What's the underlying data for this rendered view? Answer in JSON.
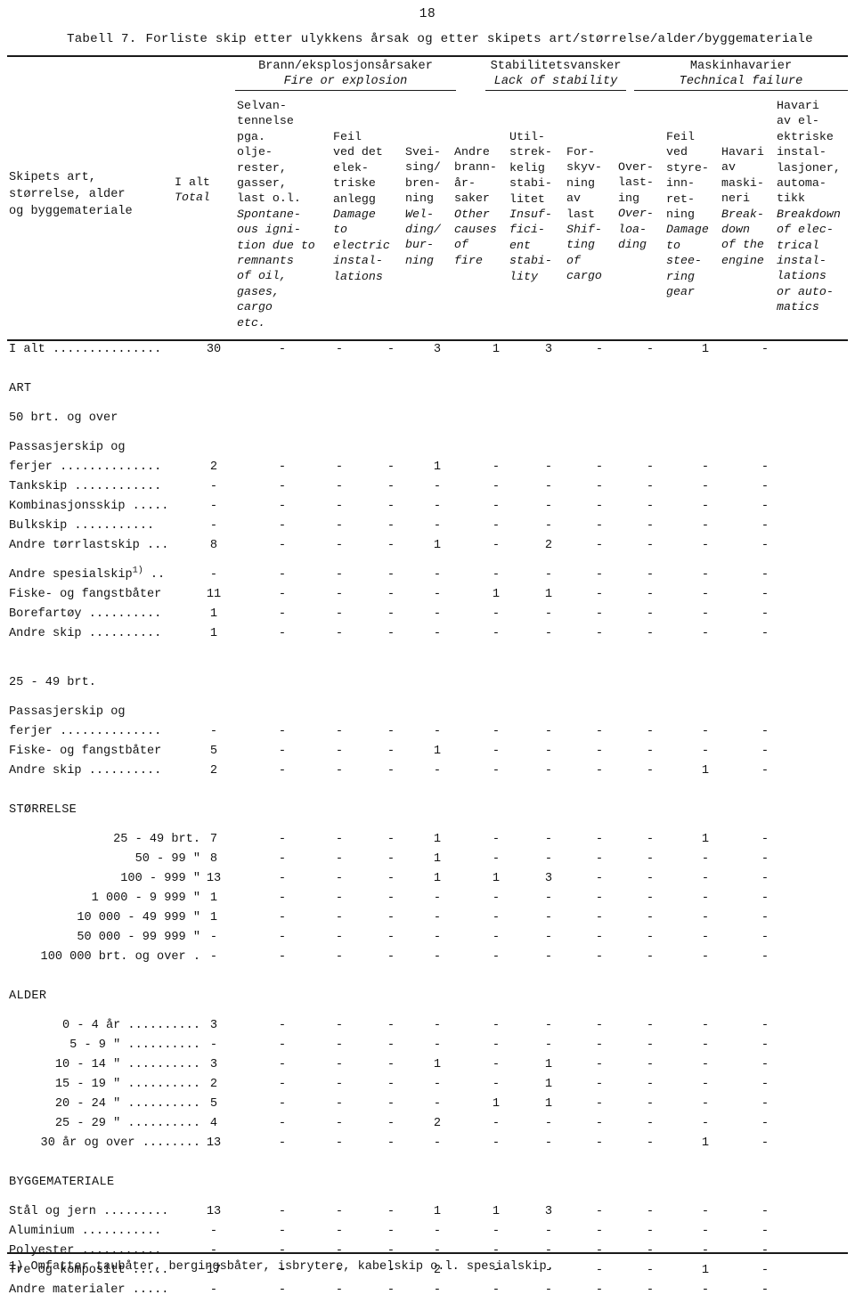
{
  "page": {
    "number": "18"
  },
  "caption": {
    "number": "Tabell 7.",
    "text": "Forliste skip etter ulykkens årsak og etter skipets art/størrelse/alder/byggemateriale"
  },
  "column_groups": [
    {
      "no": "Brann/eksplosjonsårsaker",
      "en": "Fire or explosion"
    },
    {
      "no": "Stabilitetsvansker",
      "en": "Lack of stability"
    },
    {
      "no": "Maskinhavarier",
      "en": "Technical failure"
    }
  ],
  "stub_header": {
    "line1": "Skipets art,",
    "line2": "størrelse, alder",
    "line3": "og byggemateriale"
  },
  "columns": [
    {
      "no": "I alt",
      "en": "Total"
    },
    {
      "no": "Selvan-\ntennelse\npga.\nolje-\nrester,\ngasser,\nlast o.l.",
      "en": "Spontane-\nous igni-\ntion due to\nremnants\nof oil,\ngases,\ncargo\netc."
    },
    {
      "no": "Feil\nved det\nelek-\ntriske\nanlegg",
      "en": "Damage\nto\nelectric\ninstal-\nlations"
    },
    {
      "no": "Svei-\nsing/\nbren-\nning",
      "en": "Wel-\nding/\nbur-\nning"
    },
    {
      "no": "Andre\nbrann-\når-\nsaker",
      "en": "Other\ncauses\nof\nfire"
    },
    {
      "no": "Util-\nstrek-\nkelig\nstabi-\nlitet",
      "en": "Insuf-\nfici-\nent\nstabi-\nlity"
    },
    {
      "no": "For-\nskyv-\nning\nav\nlast",
      "en": "Shif-\nting\nof\ncargo"
    },
    {
      "no": "Over-\nlast-\ning",
      "en": "Over-\nloa-\nding"
    },
    {
      "no": "Feil\nved\nstyre-\ninn-\nret-\nning",
      "en": "Damage\nto\nstee-\nring\ngear"
    },
    {
      "no": "Havari\nav\nmaski-\nneri",
      "en": "Break-\ndown\nof the\nengine"
    },
    {
      "no": "Havari\nav el-\nektriske\ninstal-\nlasjoner,\nautoma-\ntikk",
      "en": "Breakdown\nof elec-\ntrical\ninstal-\nlations\nor auto-\nmatics"
    }
  ],
  "total_row": {
    "label": "I alt ...............",
    "values": [
      "30",
      "-",
      "-",
      "-",
      "3",
      "1",
      "3",
      "-",
      "-",
      "1",
      "-"
    ]
  },
  "sections": [
    {
      "title": "ART",
      "subsections": [
        {
          "title": "50 brt. og over",
          "rows": [
            {
              "label": "Passasjerskip og",
              "label2": "ferjer ..............",
              "values": [
                "2",
                "-",
                "-",
                "-",
                "1",
                "-",
                "-",
                "-",
                "-",
                "-",
                "-"
              ]
            },
            {
              "label": "Tankskip ............",
              "values": [
                "-",
                "-",
                "-",
                "-",
                "-",
                "-",
                "-",
                "-",
                "-",
                "-",
                "-"
              ]
            },
            {
              "label": "Kombinasjonsskip .....",
              "values": [
                "-",
                "-",
                "-",
                "-",
                "-",
                "-",
                "-",
                "-",
                "-",
                "-",
                "-"
              ]
            },
            {
              "label": "Bulkskip ...........",
              "values": [
                "-",
                "-",
                "-",
                "-",
                "-",
                "-",
                "-",
                "-",
                "-",
                "-",
                "-"
              ]
            },
            {
              "label": "Andre tørrlastskip ...",
              "values": [
                "8",
                "-",
                "-",
                "-",
                "1",
                "-",
                "2",
                "-",
                "-",
                "-",
                "-"
              ]
            },
            {
              "label": "Andre spesialskip",
              "sup": "1)",
              "label_tail": " ..",
              "values": [
                "-",
                "-",
                "-",
                "-",
                "-",
                "-",
                "-",
                "-",
                "-",
                "-",
                "-"
              ]
            },
            {
              "label": "Fiske- og fangstbåter",
              "values": [
                "11",
                "-",
                "-",
                "-",
                "-",
                "1",
                "1",
                "-",
                "-",
                "-",
                "-"
              ]
            },
            {
              "label": "Borefartøy ..........",
              "values": [
                "1",
                "-",
                "-",
                "-",
                "-",
                "-",
                "-",
                "-",
                "-",
                "-",
                "-"
              ]
            },
            {
              "label": "Andre skip ..........",
              "values": [
                "1",
                "-",
                "-",
                "-",
                "-",
                "-",
                "-",
                "-",
                "-",
                "-",
                "-"
              ]
            }
          ]
        },
        {
          "title": "25 - 49 brt.",
          "rows": [
            {
              "label": "Passasjerskip og",
              "label2": "ferjer ..............",
              "values": [
                "-",
                "-",
                "-",
                "-",
                "-",
                "-",
                "-",
                "-",
                "-",
                "-",
                "-"
              ]
            },
            {
              "label": "Fiske- og fangstbåter",
              "values": [
                "5",
                "-",
                "-",
                "-",
                "1",
                "-",
                "-",
                "-",
                "-",
                "-",
                "-"
              ]
            },
            {
              "label": "Andre skip ..........",
              "values": [
                "2",
                "-",
                "-",
                "-",
                "-",
                "-",
                "-",
                "-",
                "-",
                "1",
                "-"
              ]
            }
          ]
        }
      ]
    },
    {
      "title": "STØRRELSE",
      "subsections": [
        {
          "title": "",
          "rows": [
            {
              "label": "25 -     49 brt.",
              "align": "right",
              "values": [
                "7",
                "-",
                "-",
                "-",
                "1",
                "-",
                "-",
                "-",
                "-",
                "1",
                "-"
              ]
            },
            {
              "label": "50 -     99 \"",
              "align": "right",
              "values": [
                "8",
                "-",
                "-",
                "-",
                "1",
                "-",
                "-",
                "-",
                "-",
                "-",
                "-"
              ]
            },
            {
              "label": "100 -    999 \"",
              "align": "right",
              "values": [
                "13",
                "-",
                "-",
                "-",
                "1",
                "1",
                "3",
                "-",
                "-",
                "-",
                "-"
              ]
            },
            {
              "label": "1 000 -  9 999 \"",
              "align": "right",
              "values": [
                "1",
                "-",
                "-",
                "-",
                "-",
                "-",
                "-",
                "-",
                "-",
                "-",
                "-"
              ]
            },
            {
              "label": "10 000 - 49 999 \"",
              "align": "right",
              "values": [
                "1",
                "-",
                "-",
                "-",
                "-",
                "-",
                "-",
                "-",
                "-",
                "-",
                "-"
              ]
            },
            {
              "label": "50 000 - 99 999 \"",
              "align": "right",
              "values": [
                "-",
                "-",
                "-",
                "-",
                "-",
                "-",
                "-",
                "-",
                "-",
                "-",
                "-"
              ]
            },
            {
              "label": "100 000 brt. og over .",
              "align": "right",
              "values": [
                "-",
                "-",
                "-",
                "-",
                "-",
                "-",
                "-",
                "-",
                "-",
                "-",
                "-"
              ]
            }
          ]
        }
      ]
    },
    {
      "title": "ALDER",
      "subsections": [
        {
          "title": "",
          "rows": [
            {
              "label": "0 -  4 år ..........",
              "align": "right",
              "values": [
                "3",
                "-",
                "-",
                "-",
                "-",
                "-",
                "-",
                "-",
                "-",
                "-",
                "-"
              ]
            },
            {
              "label": "5 -  9 \"  ..........",
              "align": "right",
              "values": [
                "-",
                "-",
                "-",
                "-",
                "-",
                "-",
                "-",
                "-",
                "-",
                "-",
                "-"
              ]
            },
            {
              "label": "10 - 14 \"  ..........",
              "align": "right",
              "values": [
                "3",
                "-",
                "-",
                "-",
                "1",
                "-",
                "1",
                "-",
                "-",
                "-",
                "-"
              ]
            },
            {
              "label": "15 - 19 \"  ..........",
              "align": "right",
              "values": [
                "2",
                "-",
                "-",
                "-",
                "-",
                "-",
                "1",
                "-",
                "-",
                "-",
                "-"
              ]
            },
            {
              "label": "20 - 24 \"  ..........",
              "align": "right",
              "values": [
                "5",
                "-",
                "-",
                "-",
                "-",
                "1",
                "1",
                "-",
                "-",
                "-",
                "-"
              ]
            },
            {
              "label": "25 - 29 \"  ..........",
              "align": "right",
              "values": [
                "4",
                "-",
                "-",
                "-",
                "2",
                "-",
                "-",
                "-",
                "-",
                "-",
                "-"
              ]
            },
            {
              "label": "30 år og over ........",
              "align": "right",
              "values": [
                "13",
                "-",
                "-",
                "-",
                "-",
                "-",
                "-",
                "-",
                "-",
                "1",
                "-"
              ]
            }
          ]
        }
      ]
    },
    {
      "title": "BYGGEMATERIALE",
      "subsections": [
        {
          "title": "",
          "rows": [
            {
              "label": "Stål og jern .........",
              "values": [
                "13",
                "-",
                "-",
                "-",
                "1",
                "1",
                "3",
                "-",
                "-",
                "-",
                "-"
              ]
            },
            {
              "label": "Aluminium ...........",
              "values": [
                "-",
                "-",
                "-",
                "-",
                "-",
                "-",
                "-",
                "-",
                "-",
                "-",
                "-"
              ]
            },
            {
              "label": "Polyester ...........",
              "values": [
                "-",
                "-",
                "-",
                "-",
                "-",
                "-",
                "-",
                "-",
                "-",
                "-",
                "-"
              ]
            },
            {
              "label": "Tre og kompositt .....",
              "values": [
                "17",
                "-",
                "-",
                "-",
                "2",
                "-",
                "-",
                "-",
                "-",
                "1",
                "-"
              ]
            },
            {
              "label": "Andre materialer .....",
              "values": [
                "-",
                "-",
                "-",
                "-",
                "-",
                "-",
                "-",
                "-",
                "-",
                "-",
                "-"
              ]
            }
          ]
        }
      ]
    }
  ],
  "footnote": "1) Omfatter taubåter, bergingsbåter, isbrytere, kabelskip o.l. spesialskip."
}
